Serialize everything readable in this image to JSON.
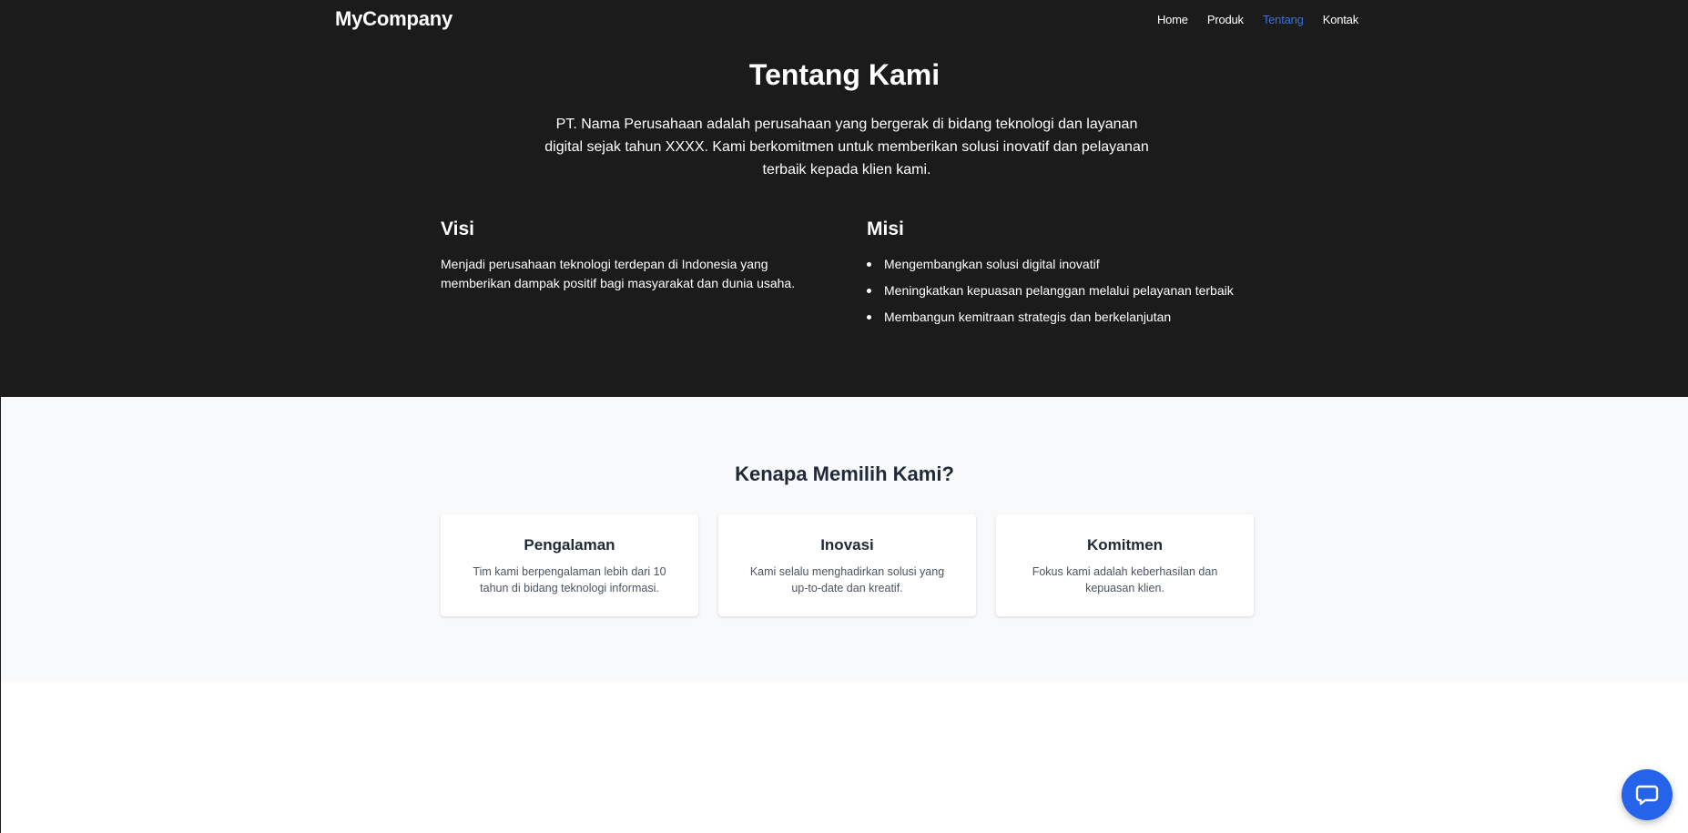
{
  "nav": {
    "brand": "MyCompany",
    "links": [
      {
        "label": "Home",
        "active": false
      },
      {
        "label": "Produk",
        "active": false
      },
      {
        "label": "Tentang",
        "active": true
      },
      {
        "label": "Kontak",
        "active": false
      }
    ]
  },
  "about": {
    "title": "Tentang Kami",
    "description": "PT. Nama Perusahaan adalah perusahaan yang bergerak di bidang teknologi dan layanan digital sejak tahun XXXX. Kami berkomitmen untuk memberikan solusi inovatif dan pelayanan terbaik kepada klien kami.",
    "visi": {
      "heading": "Visi",
      "text": "Menjadi perusahaan teknologi terdepan di Indonesia yang memberikan dampak positif bagi masyarakat dan dunia usaha."
    },
    "misi": {
      "heading": "Misi",
      "items": [
        "Mengembangkan solusi digital inovatif",
        "Meningkatkan kepuasan pelanggan melalui pelayanan terbaik",
        "Membangun kemitraan strategis dan berkelanjutan"
      ]
    }
  },
  "why": {
    "title": "Kenapa Memilih Kami?",
    "cards": [
      {
        "title": "Pengalaman",
        "text": "Tim kami berpengalaman lebih dari 10 tahun di bidang teknologi informasi."
      },
      {
        "title": "Inovasi",
        "text": "Kami selalu menghadirkan solusi yang up-to-date dan kreatif."
      },
      {
        "title": "Komitmen",
        "text": "Fokus kami adalah keberhasilan dan kepuasan klien."
      }
    ]
  },
  "chat": {
    "icon": "chat-bubble-icon"
  },
  "colors": {
    "dark_bg": "#1b1b1b",
    "light_bg": "#f8f9fa",
    "accent": "#2563eb",
    "active_link": "#3b6fd8"
  }
}
